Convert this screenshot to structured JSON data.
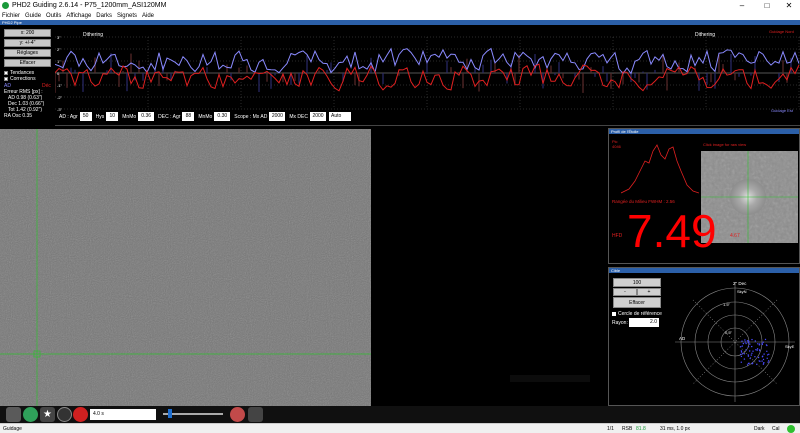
{
  "window": {
    "title": "PHD2 Guiding 2.6.14 - P75_1200mm_ASI120MM",
    "min": "–",
    "max": "□",
    "close": "✕"
  },
  "menu": [
    "Fichier",
    "Guide",
    "Outils",
    "Affichage",
    "Darks",
    "Signets",
    "Aide"
  ],
  "graph": {
    "header": "PHD2 Pipe",
    "scale_select": "x: 200",
    "y_select": "y: +/-4\"",
    "settings_btn": "Réglages",
    "clear_btn": "Effacer",
    "trends_label": "Tendances",
    "corrections_label": "Corrections",
    "ra_label": "AD",
    "dec_label": "Déc",
    "rms_title": "Erreur RMS [px] :",
    "rms_ad": "AD 0.98 (0.63\")",
    "rms_dec": "Dec 1.03 (0.66\")",
    "rms_tot": "Tot 1.42 (0.92\")",
    "ra_osc": "RA Osc 0.35",
    "dither1": "Dithering",
    "dither2": "Dithering",
    "y_ticks": [
      "3\"",
      "2\"",
      "1\"",
      "0",
      "-1\"",
      "-2\"",
      "-3\""
    ],
    "guide_top": "Guidage Nord",
    "guide_bottom": "Guidage Est",
    "colors": {
      "ra": "#8a8aff",
      "dec": "#e02020"
    }
  },
  "controls": {
    "ad_label": "AD : Agr",
    "ad_agr": "50",
    "hys_label": "Hys",
    "hys": "10",
    "mnmo_label": "MnMo",
    "mnmo": "0.36",
    "dec_label": "DEC : Agr",
    "dec_agr": "88",
    "dec_mnmo_label": "MnMo",
    "dec_mnmo": "0.30",
    "scope_label": "Scope : Mx AD",
    "mx_ad": "2000",
    "mx_dec_label": "Mx DEC",
    "mx_dec": "2000",
    "mode": "Auto"
  },
  "toolbar": {
    "exposure": "4.0 s"
  },
  "profile": {
    "header": "Profil de l'Étoile",
    "peak_label": "Pic",
    "peak_val": "4046",
    "fwhm": "Rangée du Milieu FWHM : 2.56",
    "hfd_label": "HFD",
    "hfd_value": "7.49",
    "hfd_small": "4.67",
    "click_hint": "Click image for raw view"
  },
  "target": {
    "header": "Cible",
    "zoom": "100",
    "minus": "-",
    "plus": "+",
    "clear": "Effacer",
    "ref_circle": "Cercle de référence",
    "radius_label": "Rayon:",
    "radius": "2.0",
    "dec_label": "2\" Dec",
    "skyn": "SkyN",
    "r1": "1.5\"",
    "r2": "0.5\"",
    "ad": "AD",
    "skye": "SkyE"
  },
  "status": {
    "mode": "Guidage",
    "count": "1/1",
    "rsb": "RSB",
    "rsb_val": "81.8",
    "timing": "31 ms, 1.0 px",
    "dark": "Dark",
    "cal": "Cal"
  }
}
